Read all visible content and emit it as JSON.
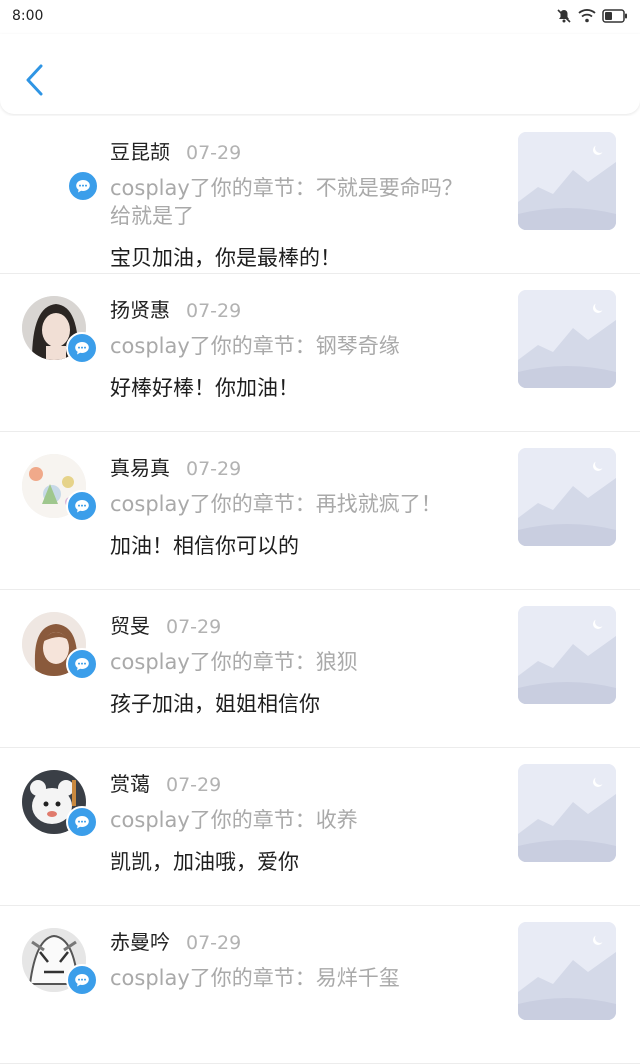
{
  "status_bar": {
    "time": "8:00"
  },
  "items": [
    {
      "name": "豆昆颉",
      "date": "07-29",
      "action": "cosplay了你的章节：不就是要命吗？给就是了",
      "comment": "宝贝加油，你是最棒的！"
    },
    {
      "name": "扬贤惠",
      "date": "07-29",
      "action": "cosplay了你的章节：钢琴奇缘",
      "comment": "好棒好棒！你加油！"
    },
    {
      "name": "真易真",
      "date": "07-29",
      "action": "cosplay了你的章节：再找就疯了！",
      "comment": "加油！相信你可以的"
    },
    {
      "name": "贸旻",
      "date": "07-29",
      "action": "cosplay了你的章节：狼狈",
      "comment": "孩子加油，姐姐相信你"
    },
    {
      "name": "赏蔼",
      "date": "07-29",
      "action": "cosplay了你的章节：收养",
      "comment": "凯凯，加油哦，爱你"
    },
    {
      "name": "赤曼吟",
      "date": "07-29",
      "action": "cosplay了你的章节：易烊千玺",
      "comment": ""
    }
  ]
}
